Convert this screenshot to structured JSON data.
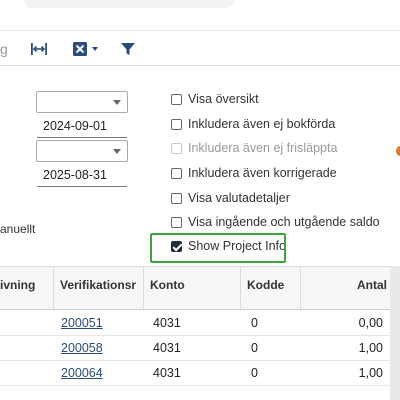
{
  "toolbar": {
    "icons": [
      "partial-icon",
      "column-width-icon",
      "excel-export-icon",
      "filter-icon"
    ],
    "partial_glyph": "g"
  },
  "filters": {
    "from_date": "2024-09-01",
    "to_date": "2025-08-31",
    "manual_label_fragment": "anuellt"
  },
  "options": [
    {
      "label": "Visa översikt",
      "checked": false,
      "disabled": false
    },
    {
      "label": "Inkludera även ej bokförda",
      "checked": false,
      "disabled": false
    },
    {
      "label": "Inkludera även ej frisläppta",
      "checked": false,
      "disabled": true
    },
    {
      "label": "Inkludera även korrigerade",
      "checked": false,
      "disabled": false
    },
    {
      "label": "Visa valutadetaljer",
      "checked": false,
      "disabled": false
    },
    {
      "label": "Visa ingående och utgående saldo",
      "checked": false,
      "disabled": false
    },
    {
      "label": "Show Project Info",
      "checked": true,
      "disabled": false
    }
  ],
  "table": {
    "columns": [
      "ivning",
      "Verifikationsr",
      "Konto",
      "Kodde",
      "Antal"
    ],
    "rows": [
      {
        "verifikation": "200051",
        "konto": "4031",
        "kodde": "0",
        "antal": "0,00"
      },
      {
        "verifikation": "200058",
        "konto": "4031",
        "kodde": "0",
        "antal": "1,00"
      },
      {
        "verifikation": "200064",
        "konto": "4031",
        "kodde": "0",
        "antal": "1,00"
      }
    ]
  },
  "colors": {
    "highlight": "#3aa33a",
    "link": "#2a4d7a",
    "accent_orange": "#e07a2a"
  }
}
